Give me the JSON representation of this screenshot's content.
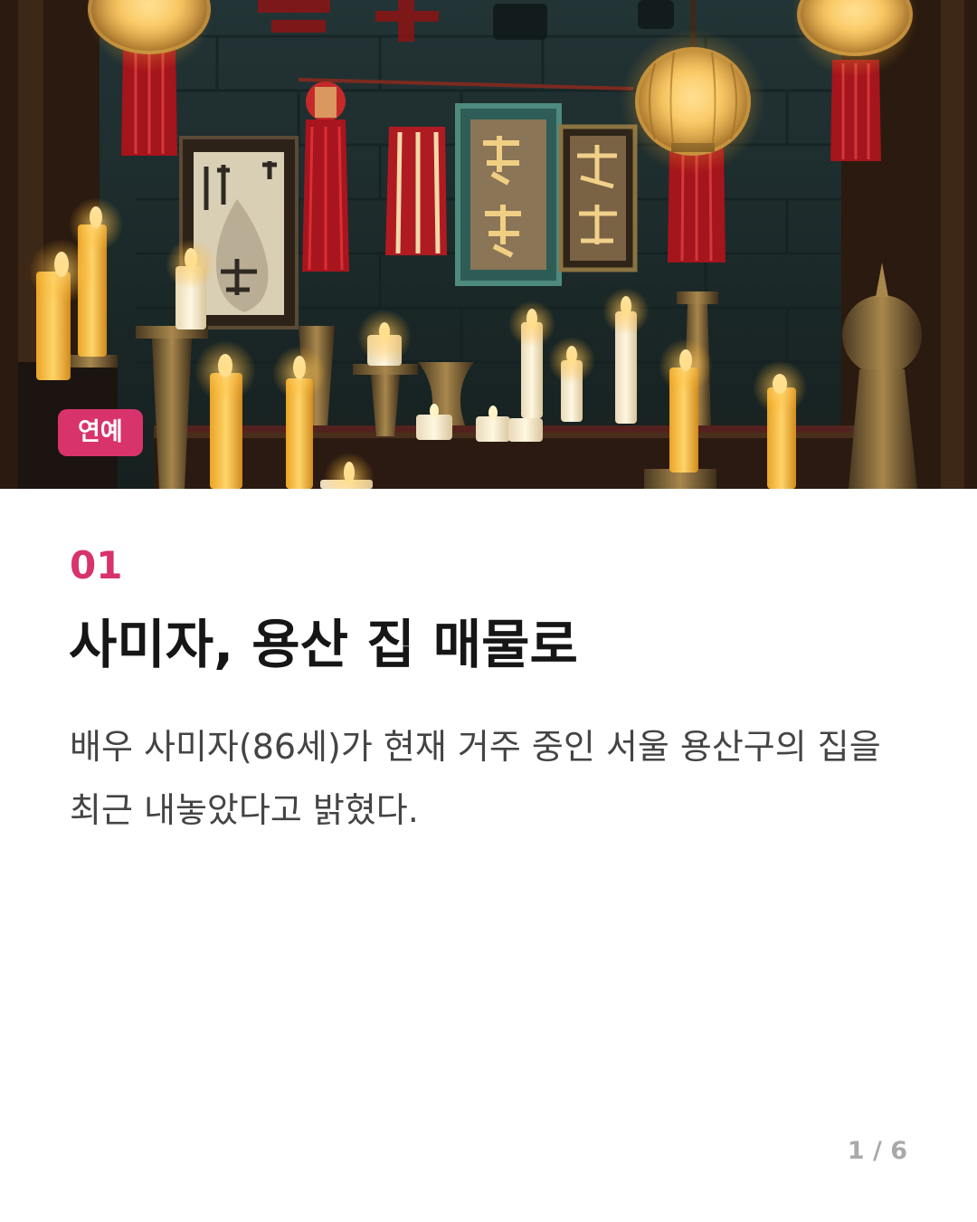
{
  "hero": {
    "image_icon": "altar-candles-lanterns-image",
    "category_badge": "연예"
  },
  "article": {
    "number": "01",
    "headline": "사미자, 용산 집 매물로",
    "body": "배우 사미자(86세)가 현재 거주 중인 서울 용산구의 집을 최근 내놓았다고 밝혔다."
  },
  "pagination": {
    "indicator": "1 / 6"
  },
  "colors": {
    "accent": "#d8336a",
    "headline": "#161616",
    "body": "#444444",
    "pagination": "#a9a9a9"
  }
}
